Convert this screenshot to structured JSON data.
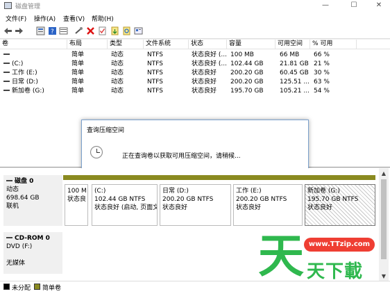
{
  "window": {
    "title": "磁盘管理",
    "minimize": "—",
    "maximize": "☐",
    "close": "✕"
  },
  "menu": [
    "文件(F)",
    "操作(A)",
    "查看(V)",
    "帮助(H)"
  ],
  "toolbar": [
    "back-icon",
    "forward-icon",
    "properties-icon",
    "help-icon",
    "volume-list-icon",
    "connect-icon",
    "delete-icon",
    "check-icon",
    "import-icon",
    "rescan-icon",
    "view-icon"
  ],
  "columns": [
    "卷",
    "布局",
    "类型",
    "文件系统",
    "状态",
    "容量",
    "可用空间",
    "% 可用"
  ],
  "volumes": [
    [
      "",
      "简单",
      "动态",
      "NTFS",
      "状态良好 (...",
      "100 MB",
      "66 MB",
      "66 %"
    ],
    [
      "(C:)",
      "简单",
      "动态",
      "NTFS",
      "状态良好 (...",
      "102.44 GB",
      "21.81 GB",
      "21 %"
    ],
    [
      "工作 (E:)",
      "简单",
      "动态",
      "NTFS",
      "状态良好",
      "200.20 GB",
      "60.45 GB",
      "30 %"
    ],
    [
      "日常 (D:)",
      "简单",
      "动态",
      "NTFS",
      "状态良好",
      "200.20 GB",
      "125.51 ...",
      "63 %"
    ],
    [
      "新加卷 (G:)",
      "简单",
      "动态",
      "NTFS",
      "状态良好",
      "195.70 GB",
      "105.21 ...",
      "54 %"
    ]
  ],
  "dialog": {
    "title": "查询压缩空间",
    "message": "正在查询卷以获取可用压缩空间，请稍候..."
  },
  "disk0": {
    "name": "磁盘 0",
    "type": "动态",
    "size": "698.64 GB",
    "status": "联机",
    "partitions": [
      {
        "name": "",
        "size": "100 M",
        "status": "状态良"
      },
      {
        "name": "(C:)",
        "size": "102.44 GB NTFS",
        "status": "状态良好 (启动, 页面文"
      },
      {
        "name": "日常  (D:)",
        "size": "200.20 GB NTFS",
        "status": "状态良好"
      },
      {
        "name": "工作  (E:)",
        "size": "200.20 GB NTFS",
        "status": "状态良好"
      },
      {
        "name": "新加卷  (G:)",
        "size": "195.70 GB NTFS",
        "status": "状态良好"
      }
    ]
  },
  "cdrom0": {
    "name": "CD-ROM 0",
    "drive": "DVD (F:)",
    "media": "无媒体"
  },
  "legend": [
    {
      "label": "未分配",
      "color": "#000000"
    },
    {
      "label": "简单卷",
      "color": "#8a8a20"
    }
  ],
  "watermark": {
    "url": "www.TTzip.com",
    "big_char": "天",
    "sub_text": "天下載"
  }
}
